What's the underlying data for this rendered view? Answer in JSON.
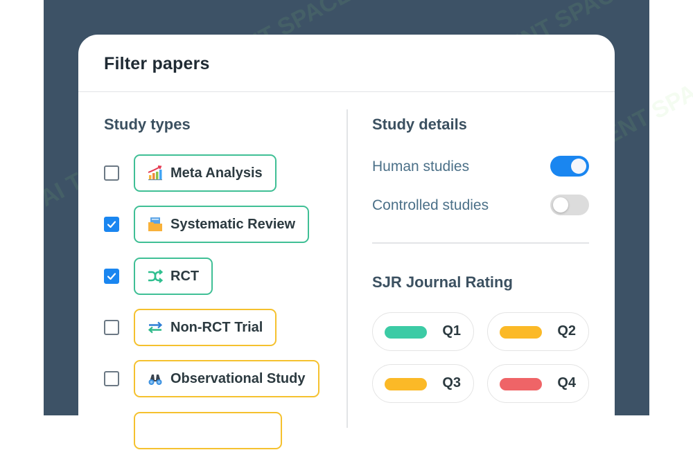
{
  "panel": {
    "title": "Filter papers",
    "study_types": {
      "heading": "Study types",
      "items": [
        {
          "label": "Meta Analysis",
          "checked": false,
          "icon": "bar-chart-trend-icon",
          "tier": "green"
        },
        {
          "label": "Systematic Review",
          "checked": true,
          "icon": "folder-icon",
          "tier": "green"
        },
        {
          "label": "RCT",
          "checked": true,
          "icon": "shuffle-icon",
          "tier": "green"
        },
        {
          "label": "Non-RCT Trial",
          "checked": false,
          "icon": "swap-arrows-icon",
          "tier": "yellow"
        },
        {
          "label": "Observational Study",
          "checked": false,
          "icon": "binoculars-icon",
          "tier": "yellow"
        }
      ]
    },
    "study_details": {
      "heading": "Study details",
      "toggles": [
        {
          "label": "Human studies",
          "on": true
        },
        {
          "label": "Controlled studies",
          "on": false
        }
      ]
    },
    "sjr": {
      "heading": "SJR Journal Rating",
      "quartiles": [
        {
          "label": "Q1",
          "color": "#3ccba5"
        },
        {
          "label": "Q2",
          "color": "#fbb927"
        },
        {
          "label": "Q3",
          "color": "#fbb927"
        },
        {
          "label": "Q4",
          "color": "#ef6467"
        }
      ]
    }
  },
  "colors": {
    "accent": "#1a86f0",
    "green_border": "#3fbf95",
    "yellow_border": "#f5c12e",
    "backdrop": "#3d5266"
  },
  "watermark": "AI TALENT SPACE"
}
